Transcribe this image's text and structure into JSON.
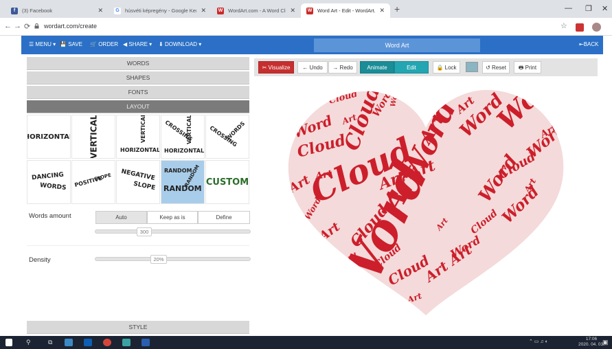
{
  "browser": {
    "tabs": [
      {
        "label": "(3) Facebook"
      },
      {
        "label": "húsvéti képregény - Google Kere"
      },
      {
        "label": "WordArt.com - A Word Cloud Art"
      },
      {
        "label": "Word Art - Edit - WordArt.com"
      }
    ],
    "url": "wordart.com/create"
  },
  "toolbar": {
    "menu": "MENU ▾",
    "save": "SAVE",
    "order": "ORDER",
    "share": "SHARE ▾",
    "download": "DOWNLOAD ▾",
    "title": "Word Art",
    "back": "BACK"
  },
  "left_panel": {
    "sections": {
      "words": "WORDS",
      "shapes": "SHAPES",
      "fonts": "FONTS",
      "layout": "LAYOUT",
      "style": "STYLE"
    },
    "layouts": {
      "horizontal": "HORIZONTAL",
      "vertical": "VERTICAL",
      "vh_vertical": "VERTICAL",
      "vh_horizontal": "HORIZONTAL",
      "crossing_a": "CROSSING",
      "crossing_b": "VERTICAL",
      "crossing_c": "HORIZONTAL",
      "crossing_words_a": "CROSSING",
      "crossing_words_b": "WORDS",
      "dancing_a": "DANCING",
      "dancing_b": "WORDS",
      "positive_a": "POSITIVE",
      "positive_b": "SLOPE",
      "negative_a": "NEGATIVE",
      "negative_b": "SLOPE",
      "random_a": "RANDOM",
      "random_b": "RANDOM",
      "random_c": "RANDOM",
      "custom": "CUSTOM"
    },
    "words_amount": {
      "label": "Words amount",
      "options": [
        "Auto",
        "Keep as is",
        "Define"
      ],
      "selected": "Auto",
      "value": "300"
    },
    "density": {
      "label": "Density",
      "value": "20%"
    }
  },
  "editor_toolbar": {
    "visualize": "Visualize",
    "undo": "Undo",
    "redo": "Redo",
    "animate": "Animate",
    "edit": "Edit",
    "lock": "Lock",
    "reset": "Reset",
    "print": "Print",
    "swatch_color": "#8ab5c2"
  },
  "canvas": {
    "shape": "heart",
    "words": [
      "Word",
      "Cloud",
      "Art"
    ],
    "color": "#cc1f2b"
  },
  "taskbar": {
    "time": "17:06",
    "date": "2020. 04. 03."
  }
}
